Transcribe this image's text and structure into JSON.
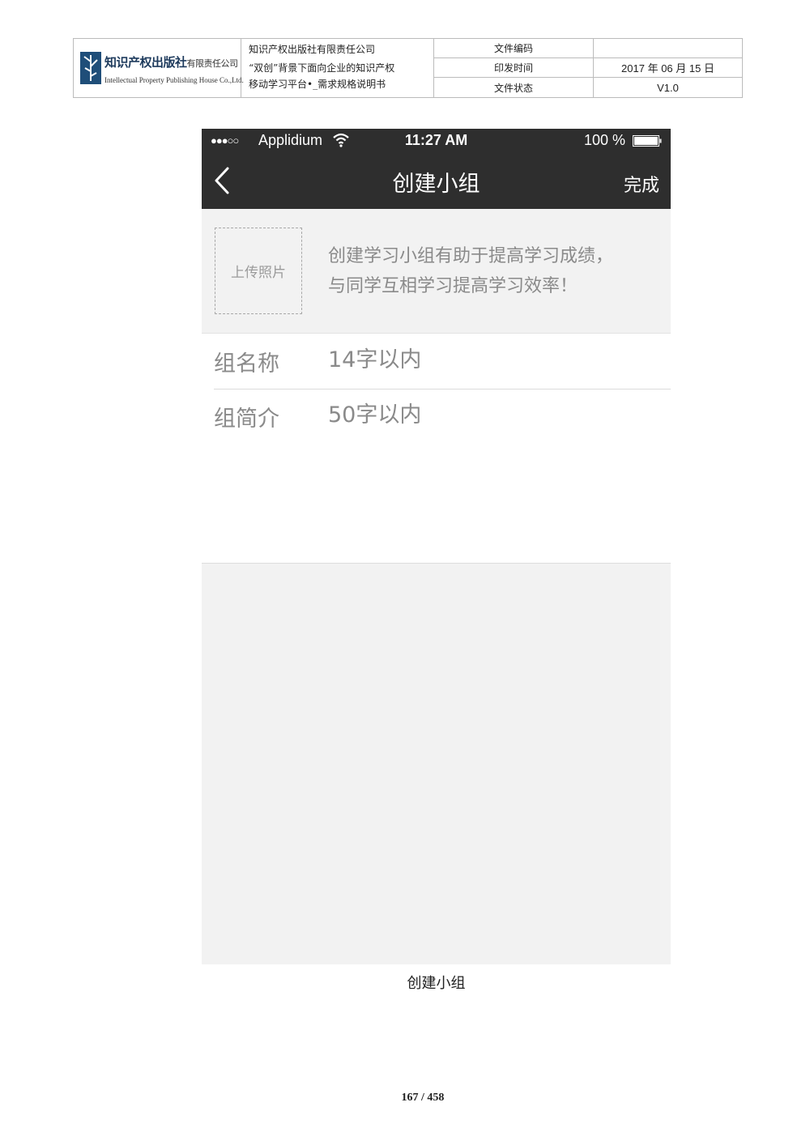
{
  "doc_header": {
    "logo_cn": "知识产权出版社",
    "logo_cn_sub": "有限责任公司",
    "logo_en": "Intellectual Property Publishing House Co.,Ltd.",
    "title_lines": [
      "知识产权出版社有限责任公司",
      "“双创”背景下面向企业的知识产权",
      "移动学习平台•_需求规格说明书"
    ],
    "doc_code_label": "文件编码",
    "doc_code_value": "",
    "issue_date_label": "印发时间",
    "issue_date_value": "2017 年 06 月 15 日",
    "status_label": "文件状态",
    "status_value": "V1.0"
  },
  "phone": {
    "status_bar": {
      "signal": "●●●○○",
      "carrier": "Applidium",
      "time": "11:27 AM",
      "battery": "100 %"
    },
    "nav": {
      "back_icon": "chevron-left-icon",
      "title": "创建小组",
      "done": "完成"
    },
    "upload": {
      "label": "上传照片",
      "tip_line1": "创建学习小组有助于提高学习成绩，",
      "tip_line2": "与同学互相学习提高学习效率！"
    },
    "form": {
      "name_label": "组名称",
      "name_placeholder": "14字以内",
      "intro_label": "组简介",
      "intro_placeholder": "50字以内"
    }
  },
  "caption": "创建小组",
  "page_number": "167 / 458",
  "colors": {
    "bar_bg": "#2e2e2e",
    "screen_bg": "#f2f2f2",
    "muted_text": "#8a8a8a"
  }
}
